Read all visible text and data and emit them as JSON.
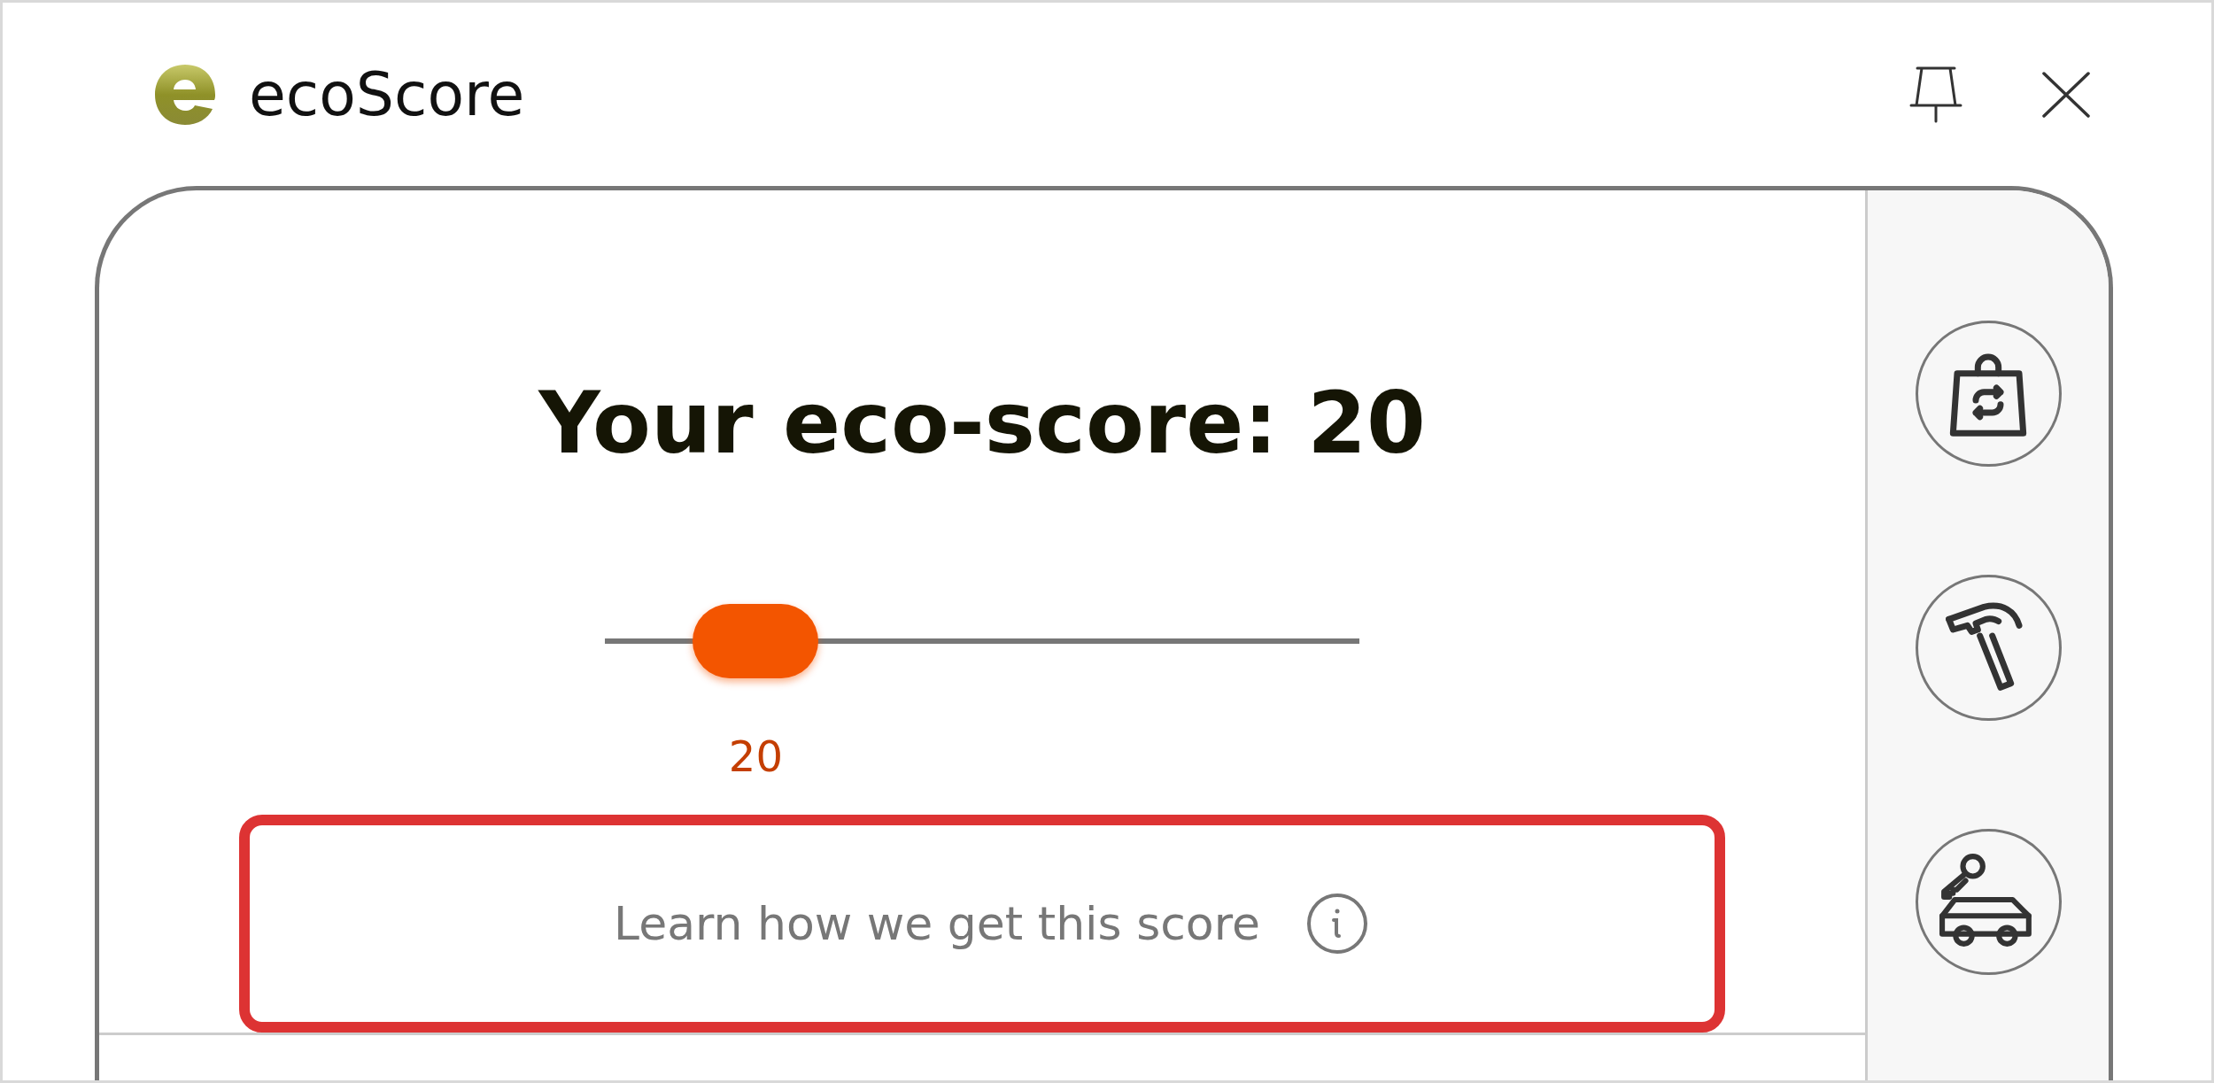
{
  "app": {
    "name": "ecoScore"
  },
  "score": {
    "title": "Your eco-score: 20",
    "level": 0.2,
    "reading": "20"
  },
  "learn_button": {
    "label": "Learn how we get this score"
  },
  "sidebar": {
    "items": [
      {
        "kind": "bag"
      },
      {
        "kind": "hammer"
      },
      {
        "kind": "car-key"
      }
    ]
  }
}
